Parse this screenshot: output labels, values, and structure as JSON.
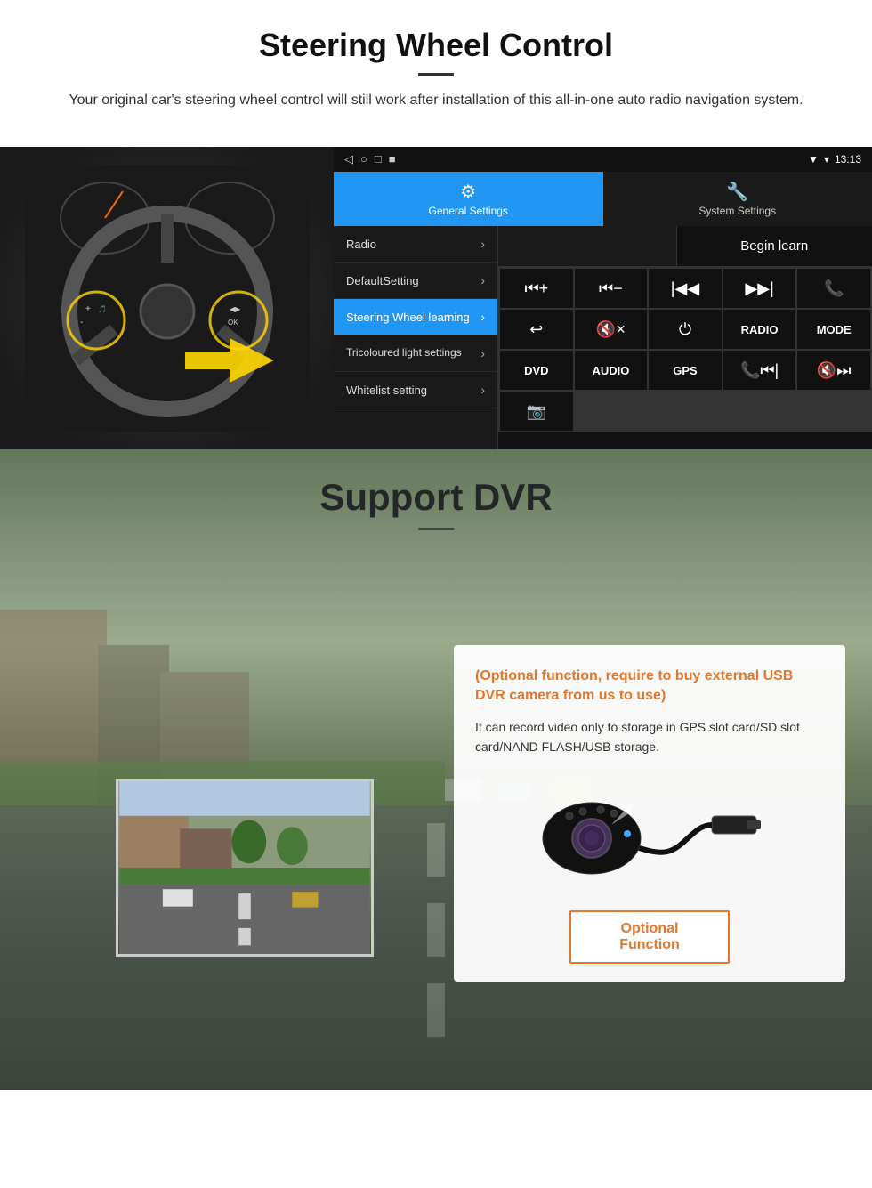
{
  "steering": {
    "title": "Steering Wheel Control",
    "description": "Your original car's steering wheel control will still work after installation of this all-in-one auto radio navigation system.",
    "statusbar": {
      "time": "13:13",
      "icons": [
        "◁",
        "○",
        "□",
        "■"
      ]
    },
    "tabs": [
      {
        "label": "General Settings",
        "icon": "⚙",
        "active": true
      },
      {
        "label": "System Settings",
        "icon": "🔧",
        "active": false
      }
    ],
    "menu": [
      {
        "label": "Radio",
        "active": false
      },
      {
        "label": "DefaultSetting",
        "active": false
      },
      {
        "label": "Steering Wheel learning",
        "active": true
      },
      {
        "label": "Tricoloured light settings",
        "active": false
      },
      {
        "label": "Whitelist setting",
        "active": false
      }
    ],
    "begin_learn": "Begin learn",
    "buttons": [
      "⏮+",
      "⏮-",
      "⏮|",
      "|⏭",
      "📞",
      "↩",
      "🔇×",
      "⏻",
      "RADIO",
      "MODE",
      "DVD",
      "AUDIO",
      "GPS",
      "📞⏮|",
      "🔇⏭"
    ],
    "extra_btn": "📷"
  },
  "dvr": {
    "title": "Support DVR",
    "optional_text": "(Optional function, require to buy external USB DVR camera from us to use)",
    "description": "It can record video only to storage in GPS slot card/SD slot card/NAND FLASH/USB storage.",
    "optional_function_label": "Optional Function"
  }
}
